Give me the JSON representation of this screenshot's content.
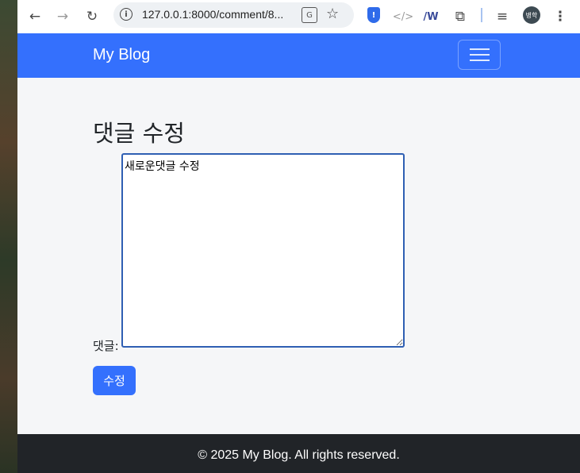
{
  "browser": {
    "url": "127.0.0.1:8000/comment/8...",
    "profile_initials": "병학"
  },
  "navbar": {
    "brand": "My Blog"
  },
  "main": {
    "title": "댓글 수정",
    "comment_label": "댓글:",
    "comment_value": "새로운댓글 수정",
    "submit_label": "수정"
  },
  "footer": {
    "text": "© 2025 My Blog. All rights reserved."
  },
  "colors": {
    "primary": "#3470fd",
    "footer_bg": "#212428",
    "page_bg": "#f5f6f8"
  }
}
